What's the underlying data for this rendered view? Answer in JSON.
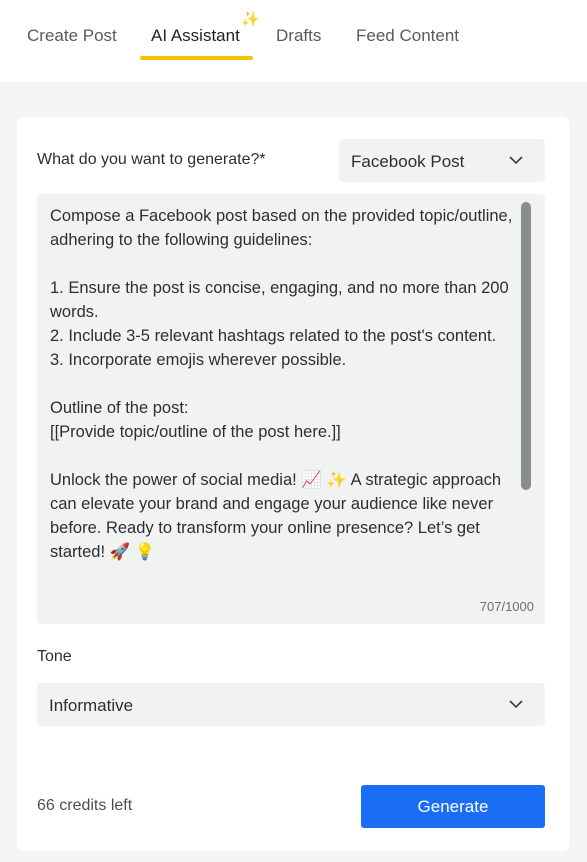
{
  "tabs": [
    {
      "label": "Create Post",
      "active": false
    },
    {
      "label": "AI Assistant",
      "active": true
    },
    {
      "label": "Drafts",
      "active": false
    },
    {
      "label": "Feed Content",
      "active": false
    }
  ],
  "tab_badge_icon": "sparkles-icon",
  "generate_type": {
    "label": "What do you want to generate?*",
    "selected": "Facebook Post"
  },
  "prompt": {
    "text": "Compose a Facebook post based on the provided topic/outline, adhering to the following guidelines:\n\n1. Ensure the post is concise, engaging, and no more than 200 words.\n2. Include 3-5 relevant hashtags related to the post's content.\n3. Incorporate emojis wherever possible.\n\nOutline of the post:\n[[Provide topic/outline of the post here.]]\n\nUnlock the power of social media! 📈 ✨ A strategic approach can elevate your brand and engage your audience like never before. Ready to transform your online presence? Let’s get started! 🚀 💡",
    "counter": "707/1000"
  },
  "tone": {
    "label": "Tone",
    "selected": "Informative"
  },
  "footer": {
    "credits": "66 credits left",
    "generate_label": "Generate"
  },
  "colors": {
    "accent_underline": "#f5c400",
    "primary_button": "#1a6ef5"
  }
}
